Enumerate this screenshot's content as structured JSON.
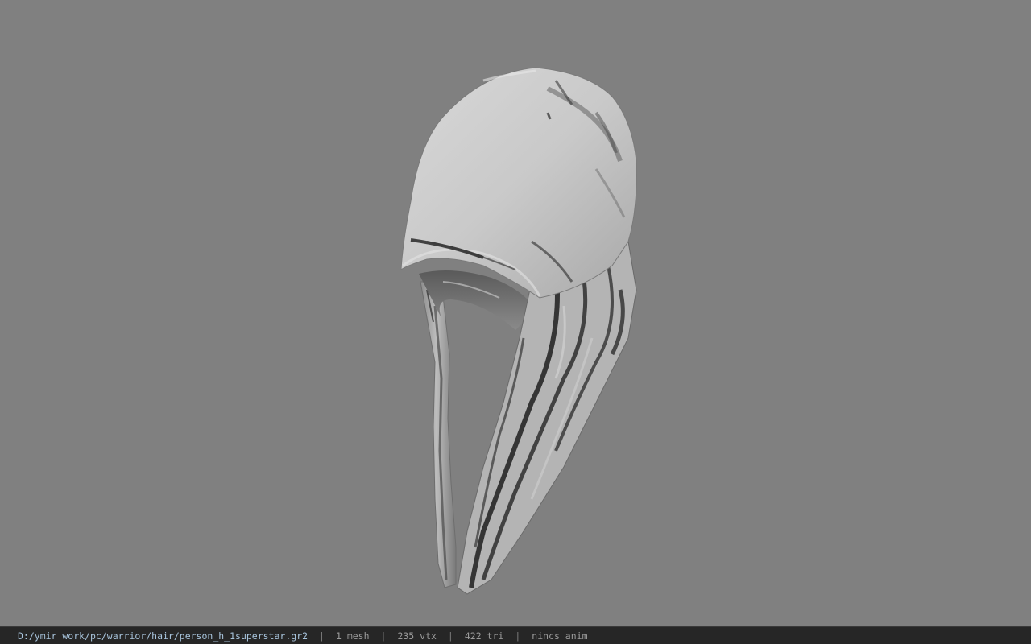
{
  "viewer": {
    "background_color": "#808080",
    "model": {
      "name": "hair-model",
      "shading": "grayscale-textured",
      "base_color": "#c2c2c2",
      "stripe_color": "#1e1e1e"
    }
  },
  "status_bar": {
    "file_path": "D:/ymir work/pc/warrior/hair/person_h_1superstar.gr2",
    "mesh_count": "1 mesh",
    "vertex_count": "235 vtx",
    "triangle_count": "422 tri",
    "animation": "nincs anim",
    "separator": "|"
  }
}
